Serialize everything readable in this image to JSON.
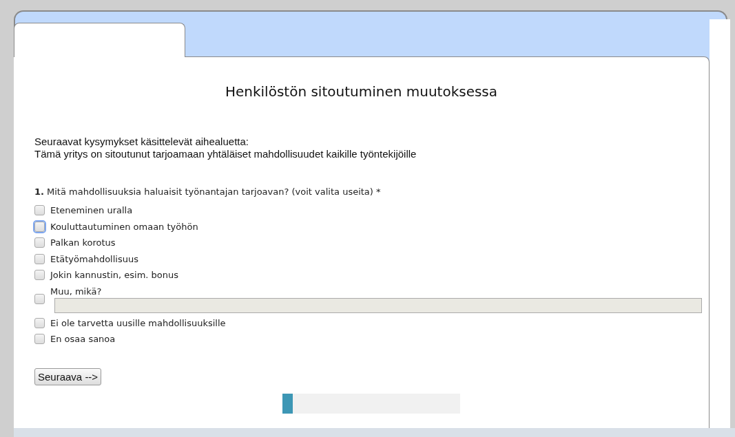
{
  "title": "Henkilöstön sitoutuminen muutoksessa",
  "intro": [
    "Seuraavat kysymykset käsittelevät aihealuetta:",
    "Tämä yritys on sitoutunut tarjoamaan yhtäläiset mahdollisuudet kaikille työntekijöille"
  ],
  "question": {
    "number": "1.",
    "text": "Mitä mahdollisuuksia haluaisit työnantajan tarjoavan? (voit valita useita) *",
    "options": [
      {
        "kind": "plain",
        "label": "Eteneminen uralla",
        "checked": false,
        "focused": false
      },
      {
        "kind": "plain",
        "label": "Kouluttautuminen omaan työhön",
        "checked": false,
        "focused": true
      },
      {
        "kind": "plain",
        "label": "Palkan korotus",
        "checked": false,
        "focused": false
      },
      {
        "kind": "plain",
        "label": "Etätyömahdollisuus",
        "checked": false,
        "focused": false
      },
      {
        "kind": "plain",
        "label": "Jokin kannustin, esim. bonus",
        "checked": false,
        "focused": false
      },
      {
        "kind": "other",
        "label": "Muu, mikä?",
        "checked": false,
        "focused": false
      },
      {
        "kind": "plain",
        "label": "Ei ole tarvetta uusille mahdollisuuksille",
        "checked": false,
        "focused": false
      },
      {
        "kind": "plain",
        "label": "En osaa sanoa",
        "checked": false,
        "focused": false
      }
    ]
  },
  "next_button": "Seuraava -->",
  "progress": {
    "level": 0.06
  }
}
